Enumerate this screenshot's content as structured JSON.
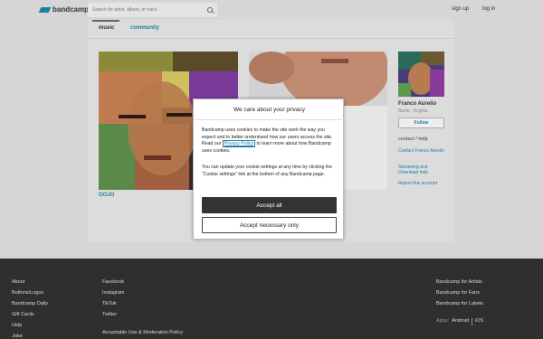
{
  "header": {
    "logo_text": "bandcamp",
    "search_placeholder": "Search for artist, album, or track",
    "signup_label": "sign up",
    "login_label": "log in"
  },
  "tabs": [
    {
      "label": "music"
    },
    {
      "label": "community"
    }
  ],
  "release": {
    "title": "GOJO"
  },
  "artist": {
    "name": "Franco Aurelio",
    "location": "Burke, Virginia",
    "follow_label": "Follow",
    "contact_heading": "contact / help",
    "links": [
      "Contact Franco Aurelio",
      "Streaming and Download help",
      "Report this account"
    ]
  },
  "cookie_modal": {
    "title": "We care about your privacy",
    "para1_before": "Bandcamp uses cookies to make the site work the way you expect and to better understand how our users access the site. Read our ",
    "para1_link": "Privacy Policy",
    "para1_after": " to learn more about how Bandcamp uses cookies.",
    "para2": "You can update your cookie settings at any time by clicking the “Cookie settings” link at the bottom of any Bandcamp page.",
    "accept_all_label": "Accept all",
    "accept_necessary_label": "Accept necessary only"
  },
  "footer": {
    "col1": [
      "About",
      "Buttons/Logos",
      "Bandcamp Daily",
      "Gift Cards",
      "Help",
      "Jobs"
    ],
    "col2": [
      "Facebook",
      "Instagram",
      "TikTok",
      "Twitter",
      "Acceptable Use & Moderation Policy"
    ],
    "col3": [
      "Bandcamp for Artists",
      "Bandcamp for Fans",
      "Bandcamp for Labels"
    ],
    "apps_label": "Apps:",
    "apps": [
      "Android",
      "iOS"
    ]
  },
  "colors": {
    "link": "#1d7fa6",
    "footer_bg": "#2f2f2f",
    "page_bg": "#d6d6d6"
  }
}
